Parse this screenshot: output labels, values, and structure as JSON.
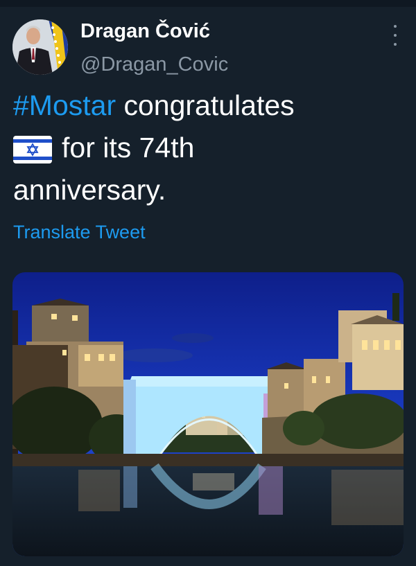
{
  "author": {
    "display_name": "Dragan Čović",
    "handle": "@Dragan_Covic",
    "avatar_icon": "profile-photo"
  },
  "tweet": {
    "hashtag": "#Mostar",
    "line1_rest": " congratulates",
    "flag_icon": "israel-flag-emoji",
    "line2_rest": "for its 74th",
    "line3": "anniversary.",
    "translate_label": "Translate Tweet"
  },
  "media": {
    "icon": "photo-old-bridge-mostar-night"
  },
  "colors": {
    "background": "#15202b",
    "accent": "#1d9bf0",
    "secondary_text": "#8b98a5",
    "bridge_light": "#aee6ff"
  },
  "icons": {
    "menu": "more-options-icon"
  }
}
